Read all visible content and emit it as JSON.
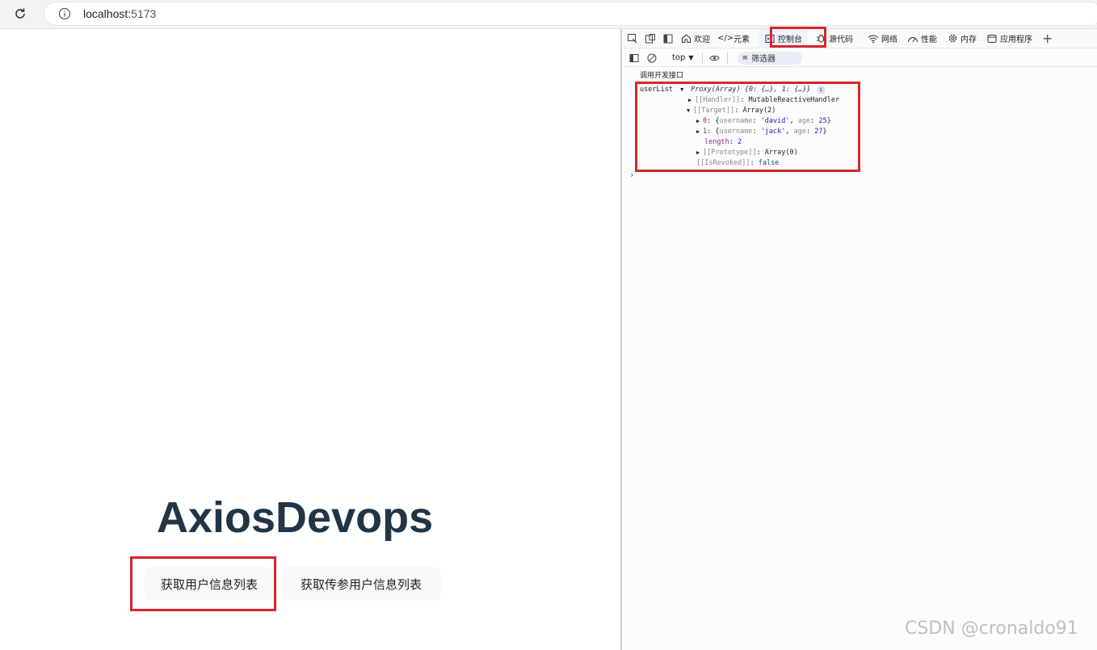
{
  "browser": {
    "url_host": "localhost:",
    "url_port": "5173"
  },
  "page": {
    "title": "AxiosDevops",
    "buttons": {
      "get_users": "获取用户信息列表",
      "get_users_params": "获取传参用户信息列表"
    }
  },
  "devtools": {
    "tabs": {
      "welcome": "欢迎",
      "elements": "元素",
      "console": "控制台",
      "sources": "源代码",
      "network": "网络",
      "performance": "性能",
      "memory": "内存",
      "application": "应用程序"
    },
    "context": "top",
    "filter_placeholder": "筛选器",
    "console": {
      "log_message": "调用开发接口",
      "var_name": "userList",
      "proxy_label": "Proxy(Array)",
      "proxy_preview": "{0: {…}, 1: {…}}",
      "handler_key": "[[Handler]]",
      "handler_val": "MutableReactiveHandler",
      "target_key": "[[Target]]",
      "target_val": "Array(2)",
      "item0_index": "0",
      "item0_user_key": "username",
      "item0_user_val": "'david'",
      "item0_age_key": "age",
      "item0_age_val": "25",
      "item1_index": "1",
      "item1_user_key": "username",
      "item1_user_val": "'jack'",
      "item1_age_key": "age",
      "item1_age_val": "27",
      "length_key": "length",
      "length_val": "2",
      "proto_key": "[[Prototype]]",
      "proto_val": "Array(0)",
      "revoked_key": "[[IsRevoked]]",
      "revoked_val": "false"
    }
  },
  "watermark": "CSDN @cronaldo91",
  "colors": {
    "highlight": "#d9252a",
    "title": "#213547"
  }
}
